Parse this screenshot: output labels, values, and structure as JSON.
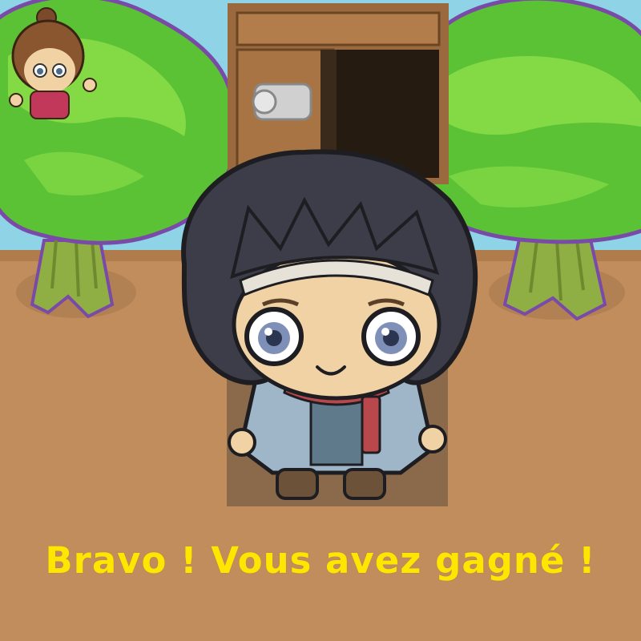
{
  "game": {
    "message": "Bravo ! Vous avez gagné !"
  },
  "colors": {
    "sky": "#8fd3e6",
    "ground": "#c18d5c",
    "ground_dark": "#b07c4c",
    "tree_leaf": "#5cc235",
    "tree_leaf_light": "#8ee04a",
    "tree_outline": "#7a4aa8",
    "trunk": "#8fae44",
    "door_wood": "#9a6a3e",
    "door_dark": "#5c3a1c",
    "door_handle": "#d0d0d0",
    "hair": "#3c3d48",
    "skin": "#f1d2a4",
    "eye": "#7e8fb8",
    "coat": "#9fb6c8",
    "scarf": "#b8484c",
    "message": "#ffe600"
  },
  "icons": {
    "player": "boy-character-icon",
    "npc": "girl-character-icon",
    "door": "wooden-door-icon"
  }
}
